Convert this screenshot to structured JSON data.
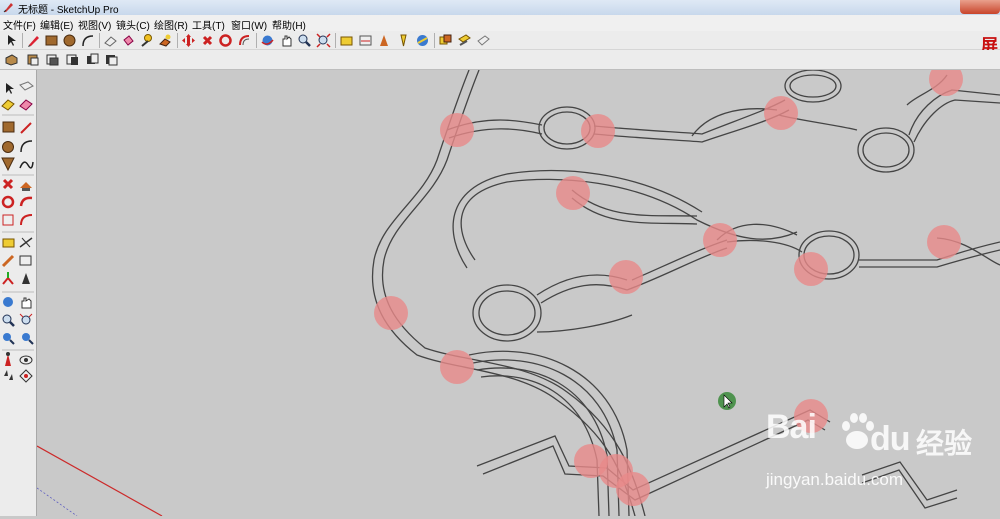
{
  "window": {
    "title": "无标题 - SketchUp Pro"
  },
  "menu": [
    {
      "label": "文件(F)"
    },
    {
      "label": "编辑(E)"
    },
    {
      "label": "视图(V)"
    },
    {
      "label": "镜头(C)"
    },
    {
      "label": "绘图(R)"
    },
    {
      "label": "工具(T)"
    },
    {
      "label": "窗口(W)"
    },
    {
      "label": "帮助(H)"
    }
  ],
  "toolbar_top": [
    "select-icon",
    "pencil-icon",
    "rectangle-icon",
    "circle-icon",
    "arc-icon",
    "eraser-icon",
    "paint-bucket-icon",
    "push-pull-icon",
    "follow-me-icon",
    "move-icon",
    "rotate-icon",
    "scale-icon",
    "offset-icon",
    "orbit-icon",
    "pan-icon",
    "zoom-icon",
    "zoom-extents-icon",
    "tape-measure-icon",
    "dimension-icon",
    "protractor-icon",
    "text-icon",
    "axes-icon",
    "3d-text-icon",
    "section-plane-icon"
  ],
  "toolbar_second": [
    "iso-view-icon",
    "top-view-icon",
    "front-view-icon",
    "right-view-icon",
    "back-view-icon",
    "left-view-icon"
  ],
  "left_toolbar": [
    "select-icon",
    "make-component-icon",
    "paint-bucket-icon",
    "eraser-icon",
    "rectangle-icon",
    "line-icon",
    "circle-icon",
    "arc-icon",
    "polygon-icon",
    "freehand-icon",
    "move-icon",
    "push-pull-icon",
    "rotate-icon",
    "follow-me-icon",
    "scale-icon",
    "offset-icon",
    "tape-measure-icon",
    "dimension-icon",
    "protractor-icon",
    "text-icon",
    "axes-icon",
    "3d-text-icon",
    "orbit-icon",
    "pan-icon",
    "zoom-icon",
    "zoom-window-icon",
    "previous-view-icon",
    "zoom-extents-icon",
    "position-camera-icon",
    "look-around-icon",
    "walk-icon",
    "section-plane-icon"
  ],
  "screen_label": "屏",
  "watermark": {
    "brand": "Bai",
    "brand2": "du",
    "cn": "经验",
    "url": "jingyan.baidu.com"
  },
  "colors": {
    "marker": "#e88a8a",
    "line": "#444444",
    "canvas": "#c9c9c9",
    "axis_red": "#cc2a2a"
  }
}
